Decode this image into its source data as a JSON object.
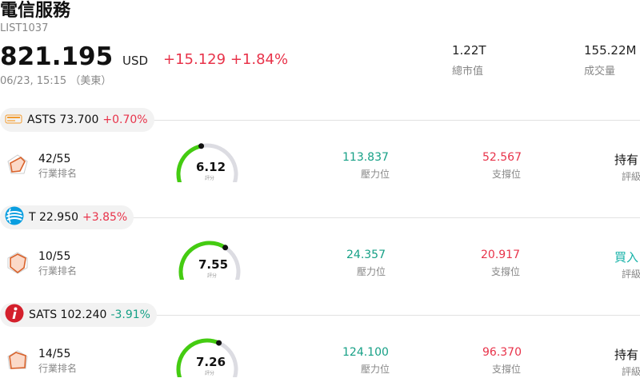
{
  "header": {
    "title": "電信服務",
    "code": "LIST1037",
    "price": "821.195",
    "currency": "USD",
    "change": "+15.129",
    "change_pct": "+1.84%",
    "timestamp": "06/23, 15:15 （美東）",
    "market_cap_value": "1.22T",
    "market_cap_label": "總市值",
    "volume_value": "155.22M",
    "volume_label": "成交量"
  },
  "colors": {
    "up": "#e8334a",
    "down": "#16a086",
    "gauge_fill": "#44cc11",
    "gauge_track": "#dcdce2"
  },
  "stocks": [
    {
      "logo_icon": "ast-logo-icon",
      "ticker": "ASTS",
      "price": "73.700",
      "change_pct": "+0.70%",
      "direction": "up",
      "rank": "42/55",
      "rank_label": "行業排名",
      "score": "6.12",
      "score_value": 6.12,
      "score_label": "評分",
      "resistance": "113.837",
      "resistance_label": "壓力位",
      "support": "52.567",
      "support_label": "支撐位",
      "rating": "持有",
      "rating_label": "評級",
      "rating_color": "#111111"
    },
    {
      "logo_icon": "att-globe-icon",
      "ticker": "T",
      "price": "22.950",
      "change_pct": "+3.85%",
      "direction": "up",
      "rank": "10/55",
      "rank_label": "行業排名",
      "score": "7.55",
      "score_value": 7.55,
      "score_label": "評分",
      "resistance": "24.357",
      "resistance_label": "壓力位",
      "support": "20.917",
      "support_label": "支撐位",
      "rating": "買入",
      "rating_label": "評級",
      "rating_color": "#16b2a8"
    },
    {
      "logo_icon": "echostar-logo-icon",
      "ticker": "SATS",
      "price": "102.240",
      "change_pct": "-3.91%",
      "direction": "down",
      "rank": "14/55",
      "rank_label": "行業排名",
      "score": "7.26",
      "score_value": 7.26,
      "score_label": "評分",
      "resistance": "124.100",
      "resistance_label": "壓力位",
      "support": "96.370",
      "support_label": "支撐位",
      "rating": "持有",
      "rating_label": "評級",
      "rating_color": "#111111"
    }
  ]
}
